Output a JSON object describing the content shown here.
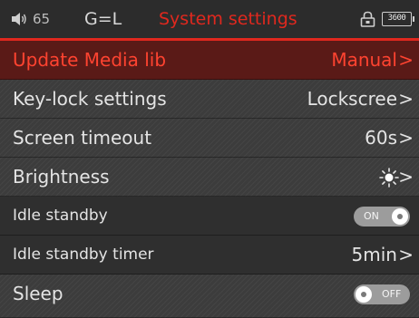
{
  "status_bar": {
    "volume_icon": "speaker-icon",
    "volume": "65",
    "eq_mode": "G=L",
    "title": "System settings",
    "lock_icon": "lock-icon",
    "battery": "3600"
  },
  "settings": [
    {
      "label": "Update Media lib",
      "value": "Manual",
      "selected": true
    },
    {
      "label": "Key-lock settings",
      "value": "Lockscree"
    },
    {
      "label": "Screen timeout",
      "value": "60s"
    },
    {
      "label": "Brightness",
      "value_icon": "brightness-icon"
    },
    {
      "label": "Idle standby",
      "toggle": "ON"
    },
    {
      "label": "Idle standby timer",
      "value": "5min"
    },
    {
      "label": "Sleep",
      "toggle": "OFF"
    }
  ],
  "chevron": ">",
  "colors": {
    "accent": "#e0281e",
    "background": "#3c3c3c",
    "text": "#e4e4e4",
    "toggle": "#9c9c9c"
  }
}
